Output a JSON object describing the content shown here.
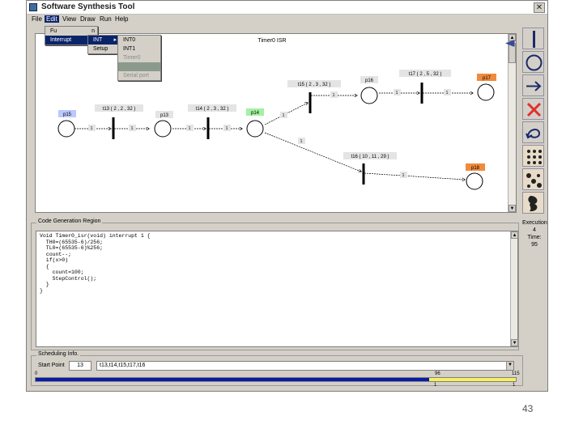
{
  "window": {
    "title": "Software Synthesis Tool",
    "close_glyph": "✕"
  },
  "menubar": {
    "items": [
      "File",
      "Edit",
      "View",
      "Draw",
      "Run",
      "Help"
    ]
  },
  "edit_menu": {
    "items": [
      {
        "label": "Fu",
        "suffix": "n"
      },
      {
        "label": "Interrupt",
        "suffix": "m"
      }
    ]
  },
  "interrupt_menu": {
    "items": [
      "INT",
      "Setup"
    ]
  },
  "int_menu": {
    "items": [
      "INT0",
      "INT1",
      "Timer0",
      "",
      "Serial port"
    ]
  },
  "canvas": {
    "caption": "Timer0 ISR",
    "places": [
      {
        "id": "p1",
        "label": "p15",
        "color": "#bcc8ff"
      },
      {
        "id": "p2",
        "label": "p13",
        "color": "#e4e4e4"
      },
      {
        "id": "p3",
        "label": "p14",
        "color": "#a4f0a4"
      },
      {
        "id": "p4",
        "label": "p16",
        "color": "#e4e4e4"
      },
      {
        "id": "p5",
        "label": "p17",
        "color": "#f08a3c"
      },
      {
        "id": "p6",
        "label": "p18",
        "color": "#f08a3c"
      }
    ],
    "transitions": [
      {
        "id": "t1",
        "label": "t13 ( 2 , 2 , 32 )"
      },
      {
        "id": "t2",
        "label": "t14 ( 2 , 3 , 32 )"
      },
      {
        "id": "t3",
        "label": "t15 ( 2 , 3 , 32 )"
      },
      {
        "id": "t4",
        "label": "t17 ( 2 , 5 , 32 )"
      },
      {
        "id": "t5",
        "label": "t16 ( 10 , 11 , 29 )"
      }
    ],
    "arc_weight": "1"
  },
  "toolbox": {
    "tools": [
      "transition-tool-icon",
      "place-tool-icon",
      "arc-tool-icon",
      "delete-tool-icon",
      "undo-tool-icon",
      "token-tool-icon",
      "net-tool-icon",
      "paint-tool-icon"
    ]
  },
  "sidepanel": {
    "lines": [
      "Execution",
      "4",
      "Time:",
      "95"
    ]
  },
  "code_region": {
    "title": "Code Generation Region",
    "lines": [
      "Void Timer0_isr(void) interrupt 1 {",
      "  TH0=(65535-6)/256;",
      "  TL0=(65535-6)%256;",
      "  count--;",
      "  if(x>0)",
      "  {",
      "    count=100;",
      "    StepControl();",
      "  }",
      "}"
    ]
  },
  "scheduling": {
    "title": "Scheduling Info.",
    "start_label": "Start Point",
    "start_value": "13",
    "sequence_value": "t13,t14,t15,t17,t16",
    "progress_percent": 82,
    "tick_start": "0",
    "tick_mid": "96",
    "tick_end": "115",
    "tick_mid_bottom": "1"
  },
  "page_number": "43"
}
